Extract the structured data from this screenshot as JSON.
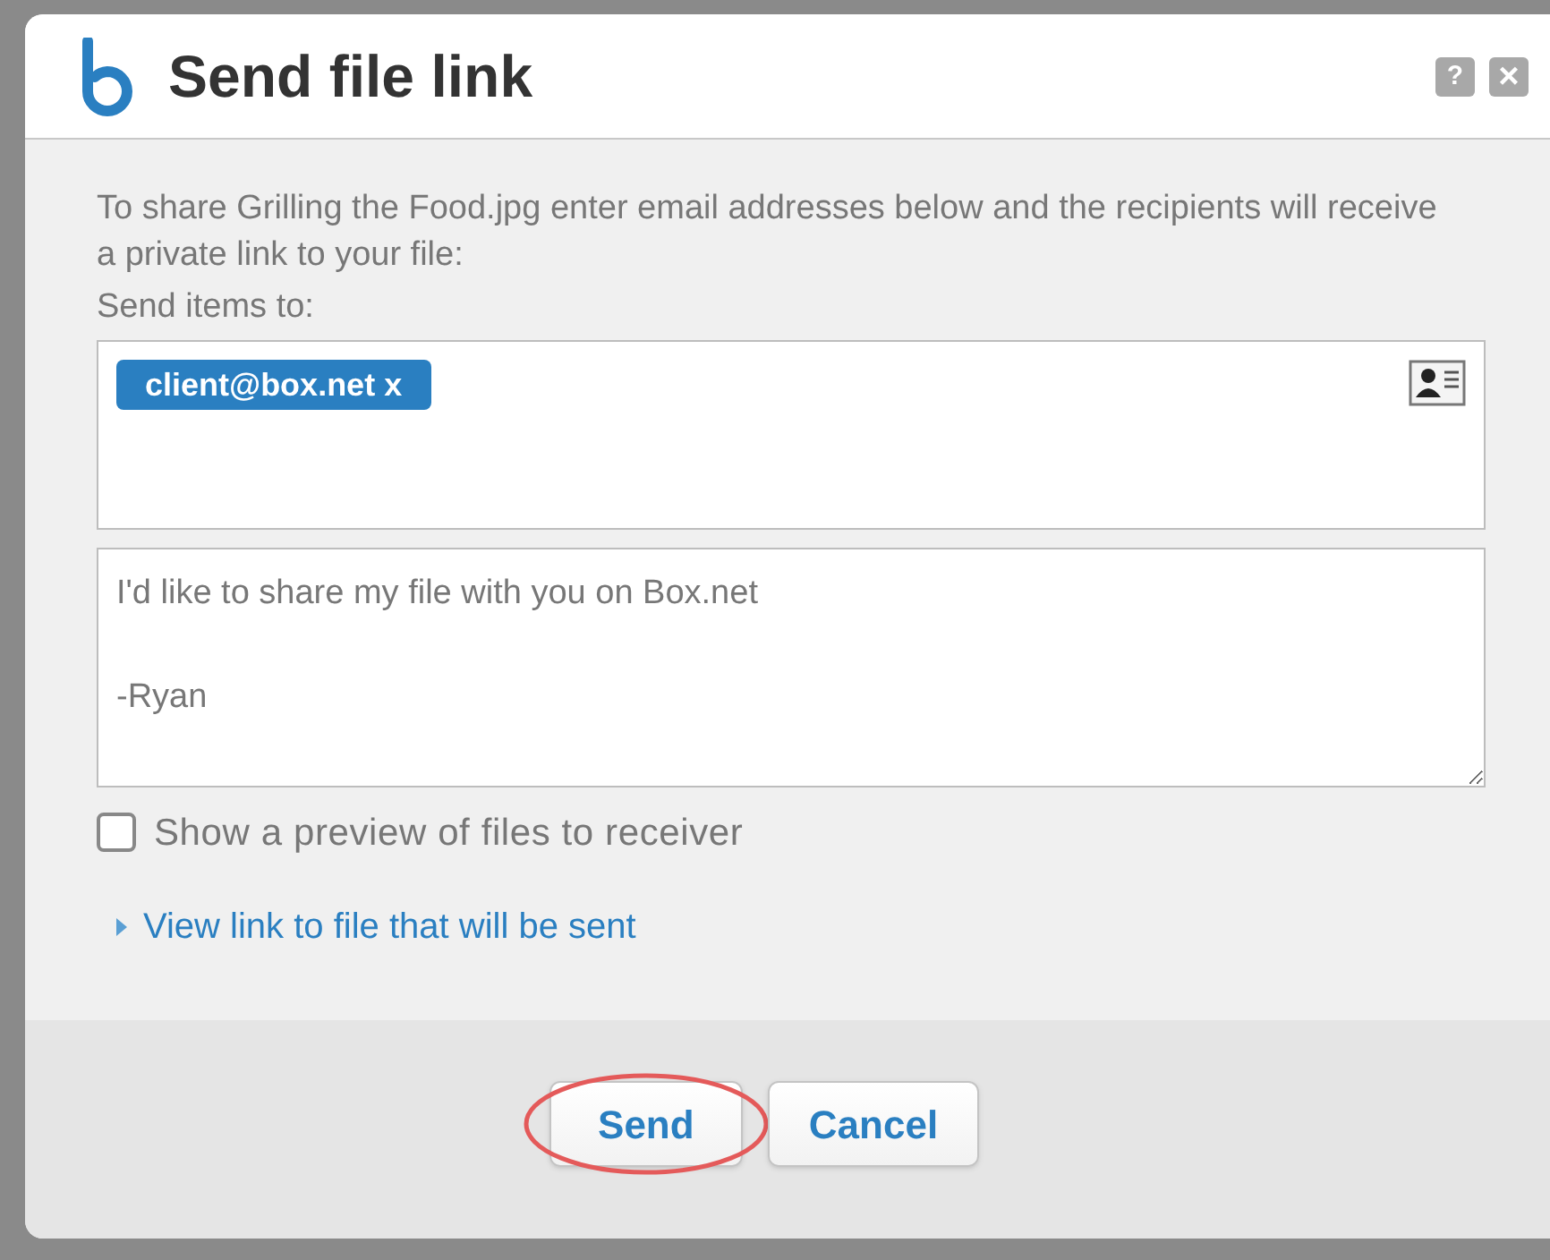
{
  "dialog": {
    "title": "Send file link",
    "help_button": "?",
    "close_button": "×"
  },
  "intro": "To share Grilling the Food.jpg enter email addresses below and the recipients will receive a private link to your file:",
  "recipients": {
    "label": "Send items to:",
    "tokens": [
      "client@box.net x"
    ]
  },
  "message": {
    "value": "I'd like to share my file with you on Box.net\n\n-Ryan"
  },
  "preview_option": {
    "label": "Show a preview of files to receiver",
    "checked": false
  },
  "link_toggle": {
    "label": "View link to file that will be sent",
    "expanded": false
  },
  "buttons": [
    {
      "label": "Send",
      "highlighted": true
    },
    {
      "label": "Cancel",
      "highlighted": false
    }
  ]
}
